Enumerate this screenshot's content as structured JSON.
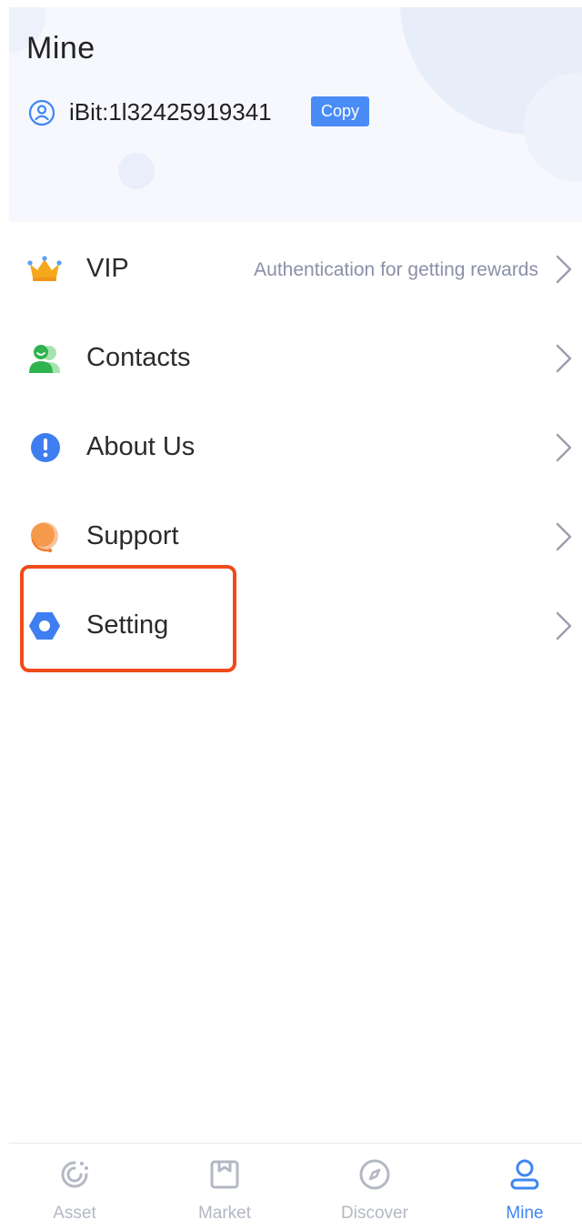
{
  "header": {
    "title": "Mine",
    "account_id": "iBit:1l32425919341",
    "copy_label": "Copy"
  },
  "menu": {
    "items": [
      {
        "label": "VIP",
        "hint": "Authentication for getting rewards",
        "icon": "crown-icon"
      },
      {
        "label": "Contacts",
        "icon": "contacts-icon"
      },
      {
        "label": "About Us",
        "icon": "info-icon"
      },
      {
        "label": "Support",
        "icon": "support-icon"
      },
      {
        "label": "Setting",
        "icon": "settings-icon"
      }
    ]
  },
  "bottom_nav": {
    "tabs": [
      {
        "label": "Asset",
        "icon": "asset-icon",
        "active": false
      },
      {
        "label": "Market",
        "icon": "market-icon",
        "active": false
      },
      {
        "label": "Discover",
        "icon": "discover-icon",
        "active": false
      },
      {
        "label": "Mine",
        "icon": "mine-icon",
        "active": true
      }
    ]
  },
  "colors": {
    "accent": "#3f86f4",
    "highlight": "#f04b1b",
    "inactive_tab": "#b4b8c4"
  }
}
